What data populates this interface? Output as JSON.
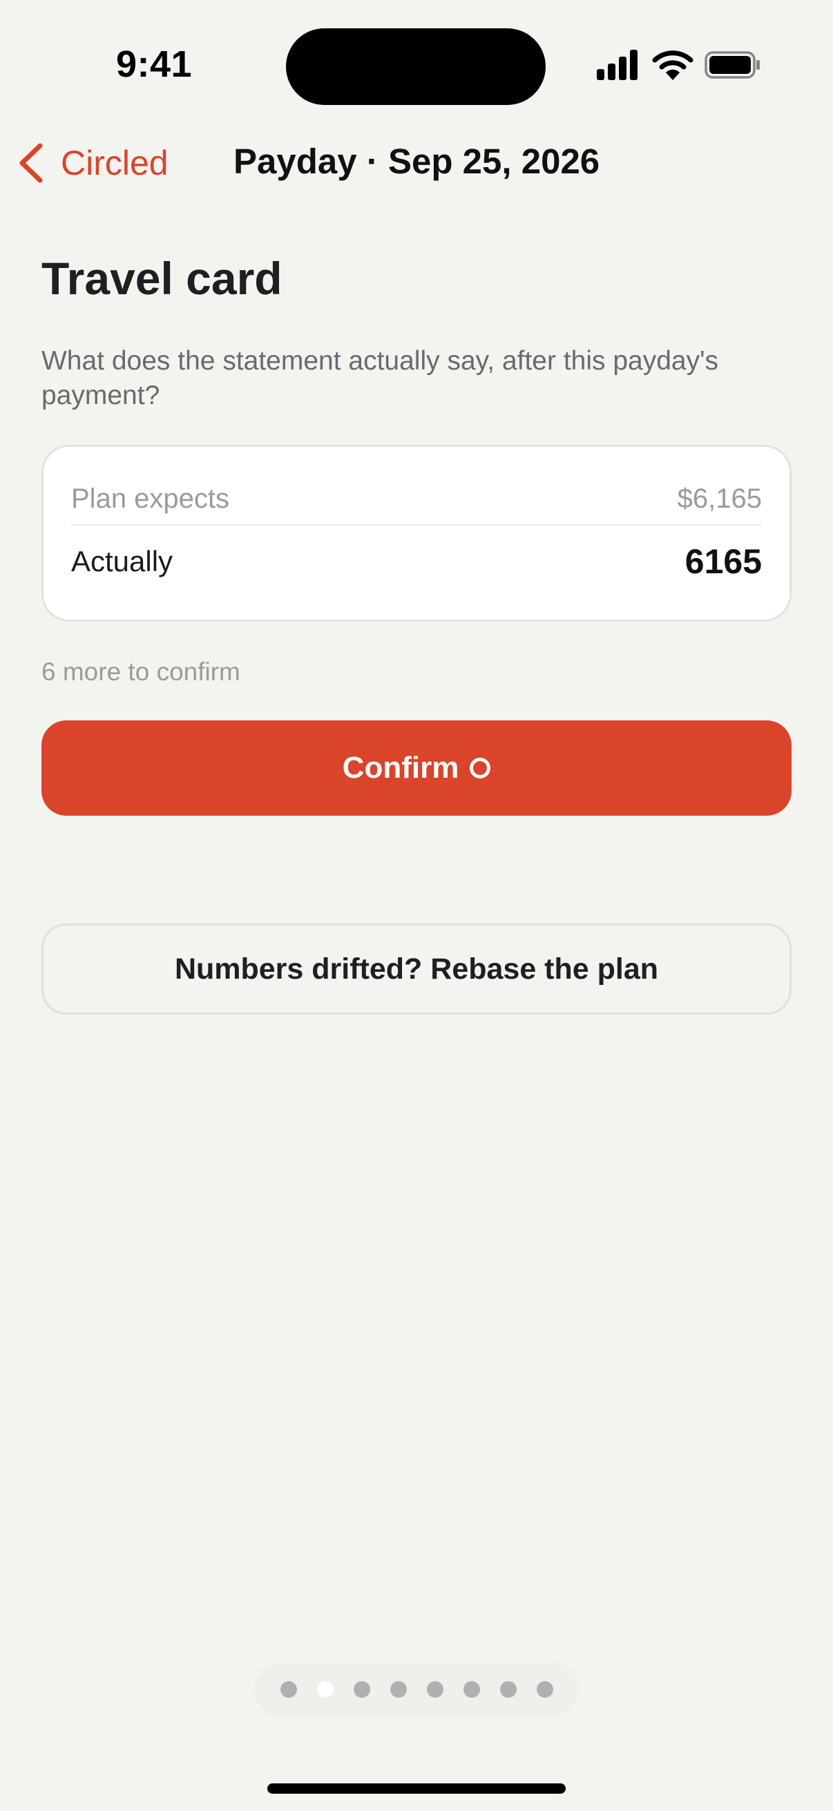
{
  "status_bar": {
    "time": "9:41",
    "icons": [
      "cellular-signal-icon",
      "wifi-icon",
      "battery-icon"
    ]
  },
  "nav": {
    "back_label": "Circled",
    "title": "Payday · Sep 25, 2026"
  },
  "page": {
    "title": "Travel card",
    "prompt": "What does the statement actually say, after this payday's payment?"
  },
  "card": {
    "expected_label": "Plan expects",
    "expected_value": "$6,165",
    "actual_label": "Actually",
    "actual_value": "6165"
  },
  "remaining_text": "6 more to confirm",
  "buttons": {
    "confirm_label": "Confirm",
    "rebase_label": "Numbers drifted? Rebase the plan"
  },
  "pagination": {
    "total": 8,
    "current": 2
  },
  "colors": {
    "accent": "#d9442b",
    "background": "#f3f3ef"
  }
}
